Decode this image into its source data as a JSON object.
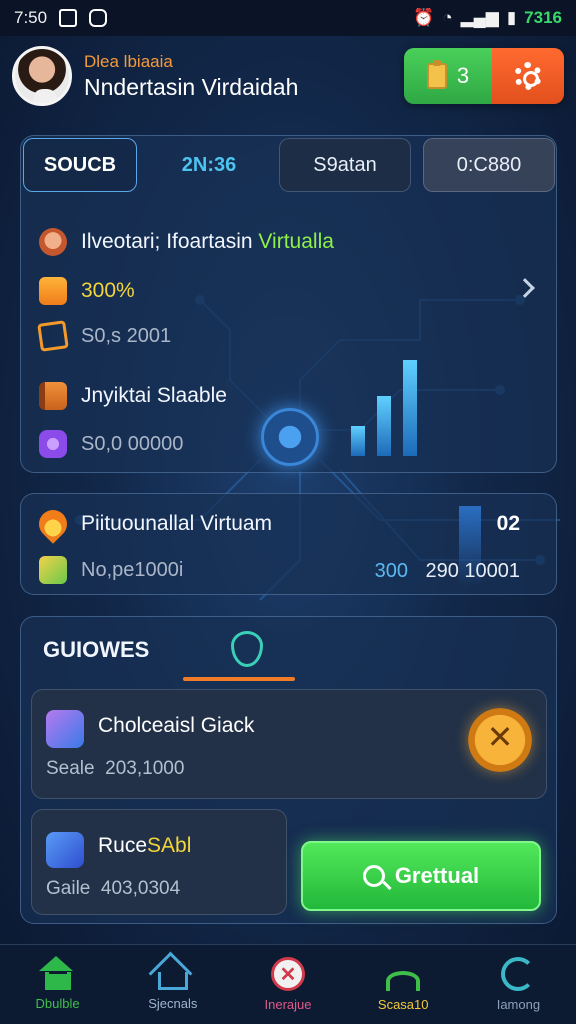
{
  "status_bar": {
    "time": "7:50",
    "battery_text": "7316"
  },
  "header": {
    "subtitle": "Dlea lbiaaia",
    "title": "Nndertasin Virdaidah",
    "coin_count": "3"
  },
  "tabs": [
    {
      "label": "SOUCB"
    },
    {
      "label": "2N:36"
    },
    {
      "label": "S9atan"
    },
    {
      "label": "0:C880"
    }
  ],
  "panel1": {
    "rows": [
      {
        "label_prefix": "Ilveotari; Ifoartasin ",
        "label_green": "Virtualla",
        "icon": "avatar-face-icon"
      },
      {
        "label": "300%",
        "icon": "document-icon"
      },
      {
        "label": "S0,s 2001",
        "icon": "chart-icon"
      },
      {
        "label": "Jnyiktai Slaable",
        "icon": "book-icon"
      },
      {
        "label": "S0,0 00000",
        "icon": "coin-purple-icon"
      }
    ]
  },
  "panel2": {
    "title": "Piituounallal Virtuam",
    "sub": "No,pe1000i",
    "value_right": "02",
    "value_mid": "300",
    "value_far": "290 10001"
  },
  "panel3": {
    "heading": "GUIOWES",
    "card1": {
      "title": "Cholceaisl Giack",
      "sub_label": "Seale",
      "sub_value": "203,1000"
    },
    "card2": {
      "title_white": "Ruce",
      "title_yellow": "SAbl",
      "sub_label": "Gaile",
      "sub_value": "403,0304"
    },
    "go_button": "Grettual"
  },
  "bottom_nav": [
    {
      "label": "Dbulble",
      "color": "#3fbf4a"
    },
    {
      "label": "Sjecnals",
      "color": "#9fb4cc"
    },
    {
      "label": "Inerajue",
      "color": "#e05a8a"
    },
    {
      "label": "Scasa10",
      "color": "#f3c93a"
    },
    {
      "label": "Iamong",
      "color": "#8ca0b8"
    }
  ],
  "colors": {
    "accent_orange": "#f07c2a",
    "accent_green": "#2fb84a",
    "accent_blue": "#4ec3f0"
  }
}
